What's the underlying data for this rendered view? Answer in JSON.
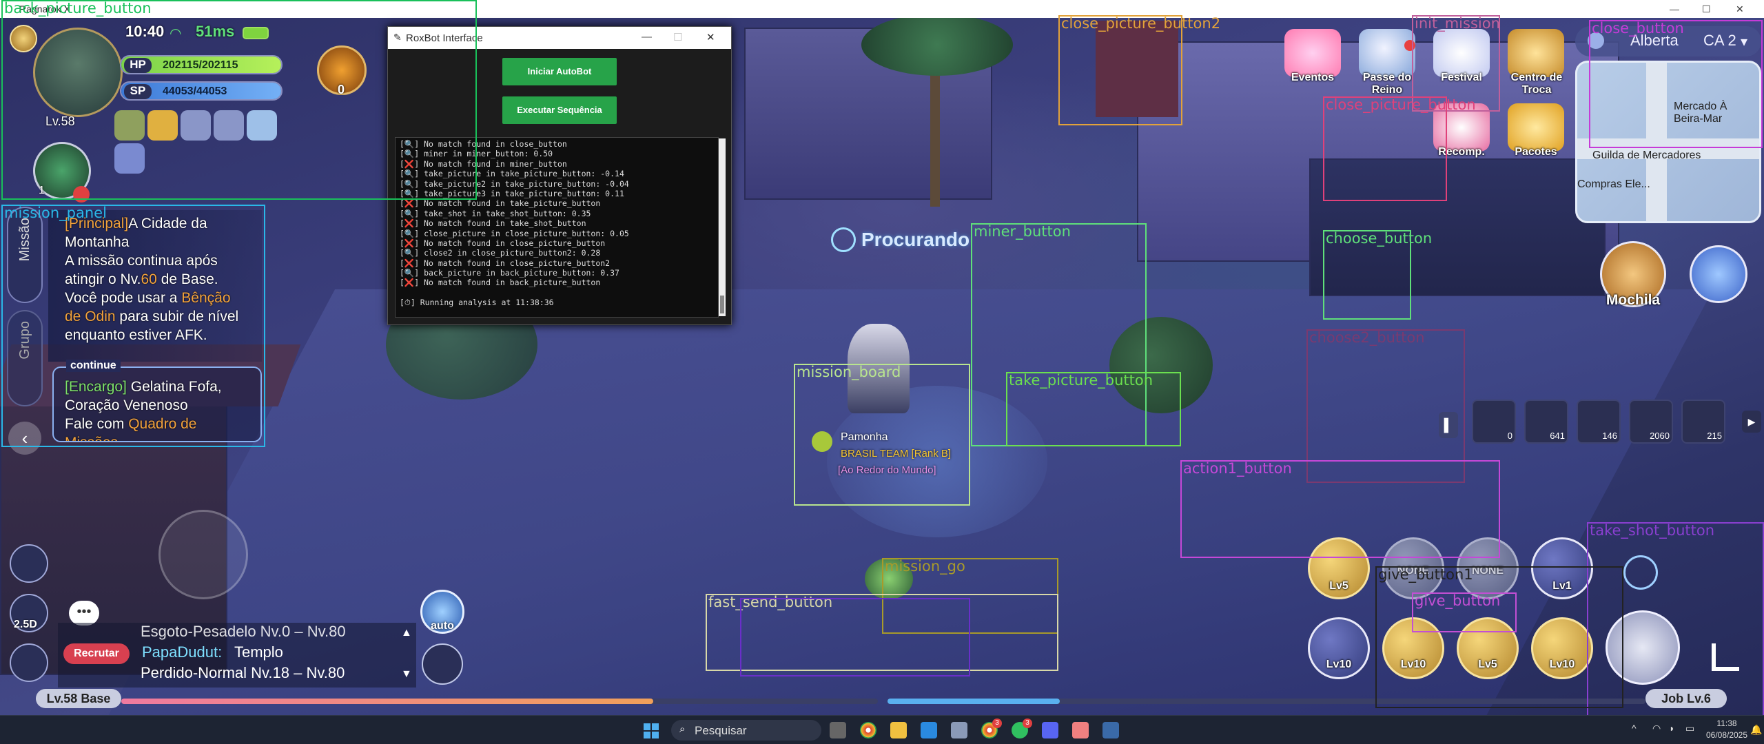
{
  "window": {
    "title": "Ragnarok X",
    "controls": [
      "—",
      "☐",
      "✕"
    ]
  },
  "player": {
    "level": "Lv.58",
    "time": "10:40",
    "ping": "51ms",
    "hp_label": "HP",
    "hp": "202115/202115",
    "hp_fraction": 1.0,
    "sp_label": "SP",
    "sp": "44053/44053",
    "sp_fraction": 1.0,
    "emblem_count": "0",
    "pet_count": "1"
  },
  "missions": {
    "tab1": "Missão",
    "tab2": "Grupo",
    "main_tag": "[Principal]",
    "main_title": "A Cidade da Montanha",
    "main_text_1": "A missão continua após atingir o Nv.",
    "main_text_level": "60",
    "main_text_2": " de Base.",
    "main_text_3": "Você pode usar a ",
    "main_text_bless": "Bênção de Odin",
    "main_text_4": " para subir de nível enquanto estiver AFK.",
    "continue": "continue",
    "quest_tag": "[Encargo]",
    "quest_title": "Gelatina Fofa, Coração Venenoso",
    "quest_text": "Fale com ",
    "quest_board": "Quadro de Missões"
  },
  "searching": "Procurando",
  "character": {
    "name": "Pamonha",
    "guild": "BRASIL TEAM [Rank B]",
    "title": "[Ao Redor do Mundo]"
  },
  "top_menu": [
    {
      "label": "Eventos"
    },
    {
      "label": "Passe do Reino"
    },
    {
      "label": "Festival"
    },
    {
      "label": "Centro de Troca"
    },
    {
      "label": "Recomp."
    },
    {
      "label": "Pacotes"
    }
  ],
  "map": {
    "region": "Alberta",
    "channel": "CA 2",
    "poi_1": "Mercado À Beira-Mar",
    "poi_2": "Guilda de Mercadores",
    "poi_3": "Compras Ele..."
  },
  "backpack_label": "Mochila",
  "items": [
    {
      "count": "0"
    },
    {
      "count": "641"
    },
    {
      "count": "146"
    },
    {
      "count": "2060"
    },
    {
      "count": "215"
    }
  ],
  "skills_row1": [
    {
      "level": "Lv5"
    },
    {
      "level": "NONE"
    },
    {
      "level": "NONE"
    },
    {
      "level": "Lv1"
    }
  ],
  "skills_row2": [
    {
      "level": "Lv10"
    },
    {
      "level": "Lv10"
    },
    {
      "level": "Lv5"
    },
    {
      "level": "Lv10"
    }
  ],
  "chat": {
    "line1": "Esgoto-Pesadelo Nv.0 – Nv.80",
    "recruit": "Recrutar",
    "user": "PapaDudut:",
    "line2": "Templo",
    "line3": "Perdido-Normal Nv.18 – Nv.80"
  },
  "auto_label": "auto",
  "view_label": "2.5D",
  "bottom": {
    "base_level": "Lv.58 Base",
    "job_level": "Job Lv.6"
  },
  "roxbot": {
    "title": "RoxBot Interface",
    "btn_start": "Iniciar AutoBot",
    "btn_seq": "Executar Sequência",
    "log": [
      "[🔍] No match found in close_button",
      "[🔍] miner in miner_button: 0.50",
      "[❌] No match found in miner_button",
      "[🔍] take_picture in take_picture_button: -0.14",
      "[🔍] take_picture2 in take_picture_button: -0.04",
      "[🔍] take_picture3 in take_picture_button: 0.11",
      "[❌] No match found in take_picture_button",
      "[🔍] take_shot in take_shot_button: 0.35",
      "[❌] No match found in take_shot_button",
      "[🔍] close_picture in close_picture_button: 0.05",
      "[❌] No match found in close_picture_button",
      "[🔍] close2 in close_picture_button2: 0.28",
      "[❌] No match found in close_picture_button2",
      "[🔍] back_picture in back_picture_button: 0.37",
      "[❌] No match found in back_picture_button",
      "",
      "[⏱] Running analysis at 11:38:36"
    ]
  },
  "detections": [
    {
      "label": "back_picture_button",
      "color": "#19c05a"
    },
    {
      "label": "mission_panel",
      "color": "#2ab8e8"
    },
    {
      "label": "close_picture_button2",
      "color": "#e2a23a"
    },
    {
      "label": "init_mission",
      "color": "#c0609c"
    },
    {
      "label": "close_button",
      "color": "#c63bd8"
    },
    {
      "label": "close_picture_button",
      "color": "#e0417a"
    },
    {
      "label": "miner_button",
      "color": "#5fe07a"
    },
    {
      "label": "choose_button",
      "color": "#5fe07a"
    },
    {
      "label": "choose2_button",
      "color": "#7a3a70"
    },
    {
      "label": "mission_board",
      "color": "#b9e58e"
    },
    {
      "label": "take_picture_button",
      "color": "#6be04f"
    },
    {
      "label": "action1_button",
      "color": "#c548d8"
    },
    {
      "label": "take_shot_button",
      "color": "#8a3fd0"
    },
    {
      "label": "give_button1",
      "color": "#222222"
    },
    {
      "label": "give_button",
      "color": "#c34fd4"
    },
    {
      "label": "mission_go",
      "color": "#a89a2a"
    },
    {
      "label": "fast_send_button",
      "color": "#d8d8a8"
    },
    {
      "label": "",
      "color": "#6a2fc9"
    }
  ],
  "taskbar": {
    "search": "Pesquisar",
    "time": "11:38",
    "date": "06/08/2025",
    "badge1": "3",
    "badge2": "3"
  }
}
